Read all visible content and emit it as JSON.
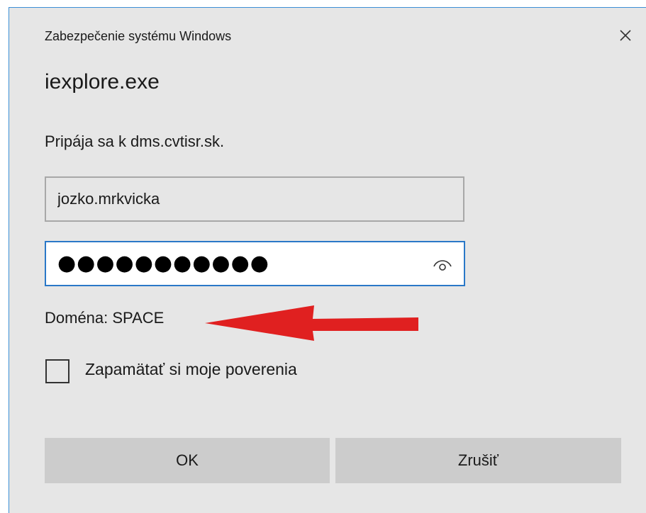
{
  "window": {
    "title": "Zabezpečenie systému Windows",
    "close_icon": "close-icon"
  },
  "dialog": {
    "app_name": "iexplore.exe",
    "connecting_text": "Pripája sa k dms.cvtisr.sk.",
    "domain_text": "Doména: SPACE"
  },
  "form": {
    "username_value": "jozko.mrkvicka",
    "password_masked": "●●●●●●●●●●●",
    "reveal_icon": "eye-icon",
    "remember_label": "Zapamätať si moje poverenia",
    "remember_checked": false
  },
  "buttons": {
    "ok_label": "OK",
    "cancel_label": "Zrušiť"
  },
  "annotation": {
    "arrow_icon": "red-arrow-icon",
    "arrow_color": "#e02020"
  },
  "colors": {
    "dialog_bg": "#e6e6e6",
    "focus_border": "#2a78c8",
    "button_bg": "#cccccc"
  }
}
